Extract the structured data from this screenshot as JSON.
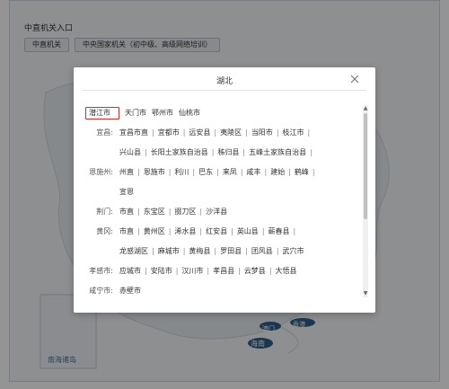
{
  "header": {
    "section_title": "中直机关入口",
    "tabs": [
      "中直机关",
      "中央国家机关（初中级、高级网络培训）"
    ]
  },
  "map": {
    "labels": [
      "澳门",
      "香港",
      "海南",
      "南海诸岛"
    ]
  },
  "modal": {
    "title": "湖北",
    "close_icon": "close-icon",
    "highlighted_city": "潜江市",
    "rows": [
      {
        "label": "",
        "items": [
          "天门市",
          "鄂州市",
          "仙桃市"
        ]
      },
      {
        "label": "宜昌:",
        "items": [
          "宜昌市直",
          "宜都市",
          "远安县",
          "夷陵区",
          "当阳市",
          "枝江市"
        ]
      },
      {
        "label": "",
        "items": [
          "兴山县",
          "长阳土家族自治县",
          "秭归县",
          "五峰土家族自治县"
        ]
      },
      {
        "label": "恩施州:",
        "items": [
          "州直",
          "恩施市",
          "利川",
          "巴东",
          "来凤",
          "咸丰",
          "建始",
          "鹤峰"
        ]
      },
      {
        "label": "",
        "items": [
          "宣恩"
        ]
      },
      {
        "label": "荆门:",
        "items": [
          "市直",
          "东宝区",
          "掇刀区",
          "沙洋县"
        ]
      },
      {
        "label": "黄冈:",
        "items": [
          "市直",
          "黄州区",
          "浠水县",
          "红安县",
          "英山县",
          "蕲春县"
        ]
      },
      {
        "label": "",
        "items": [
          "龙感湖区",
          "麻城市",
          "黄梅县",
          "罗田县",
          "团风县",
          "武穴市"
        ]
      },
      {
        "label": "孝感市:",
        "items": [
          "应城市",
          "安陆市",
          "汉川市",
          "孝昌县",
          "云梦县",
          "大悟县"
        ]
      },
      {
        "label": "咸宁市:",
        "items": [
          "赤壁市"
        ]
      }
    ]
  },
  "colors": {
    "highlight_border": "#d42b2b",
    "overlay": "rgba(0,0,0,0.42)"
  }
}
